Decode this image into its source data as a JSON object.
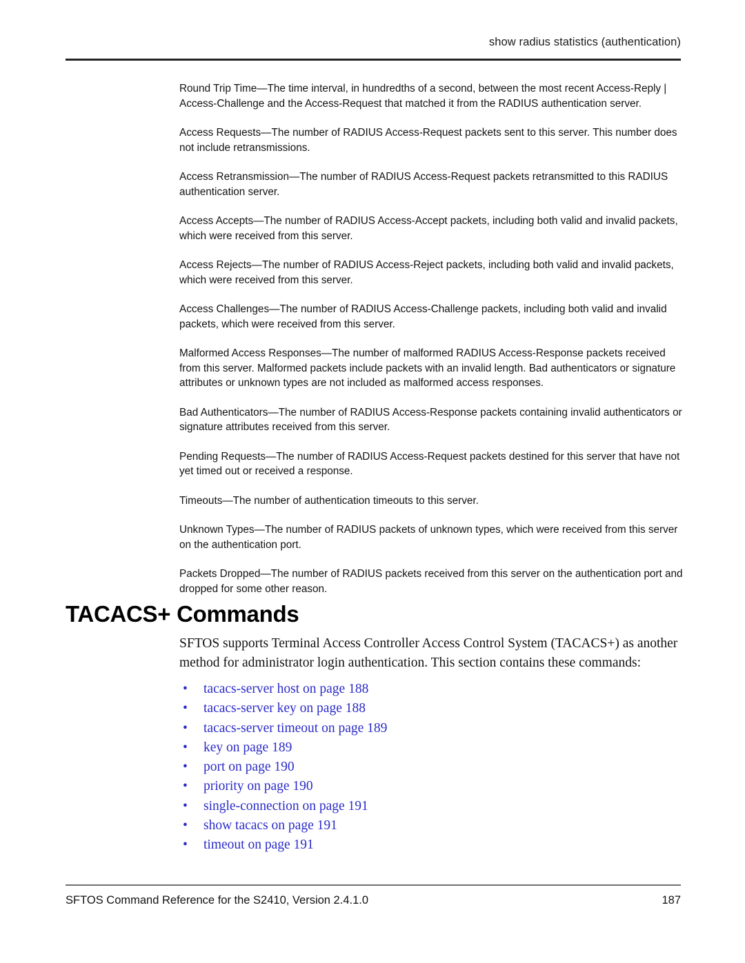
{
  "header": {
    "running_title": "show radius statistics (authentication)"
  },
  "body": {
    "paragraphs": [
      "Round Trip Time—The time interval, in hundredths of a second, between the most recent Access-Reply | Access-Challenge and the Access-Request that matched it from the RADIUS authentication server.",
      "Access Requests—The number of RADIUS Access-Request packets sent to this server. This number does not include retransmissions.",
      "Access Retransmission—The number of RADIUS Access-Request packets retransmitted to this RADIUS authentication server.",
      "Access Accepts—The number of RADIUS Access-Accept packets, including both valid and invalid packets, which were received from this server.",
      "Access Rejects—The number of RADIUS Access-Reject packets, including both valid and invalid packets, which were received from this server.",
      "Access Challenges—The number of RADIUS Access-Challenge packets, including both valid and invalid packets, which were received from this server.",
      "Malformed Access Responses—The number of malformed RADIUS Access-Response packets received from this server. Malformed packets include packets with an invalid length. Bad authenticators or signature attributes or unknown types are not included as malformed access responses.",
      "Bad Authenticators—The number of RADIUS Access-Response packets containing invalid authenticators or signature attributes received from this server.",
      "Pending Requests—The number of RADIUS Access-Request packets destined for this server that have not yet timed out or received a response.",
      "Timeouts—The number of authentication timeouts to this server.",
      "Unknown Types—The number of RADIUS packets of unknown types, which were received from this server on the authentication port.",
      "Packets Dropped—The number of RADIUS packets received from this server on the authentication port and dropped for some other reason."
    ]
  },
  "section": {
    "heading": "TACACS+ Commands",
    "intro": "SFTOS supports Terminal Access Controller Access Control System (TACACS+) as another method for administrator login authentication. This section contains these commands:",
    "bullet_glyph": "•",
    "link_color": "#2b2bc9",
    "links": [
      {
        "label": "tacacs-server host on page 188"
      },
      {
        "label": "tacacs-server key on page 188"
      },
      {
        "label": "tacacs-server timeout on page 189"
      },
      {
        "label": "key on page 189"
      },
      {
        "label": "port on page 190"
      },
      {
        "label": "priority on page 190"
      },
      {
        "label": "single-connection on page 191"
      },
      {
        "label": "show tacacs on page 191"
      },
      {
        "label": "timeout on page 191"
      }
    ]
  },
  "footer": {
    "document_title": "SFTOS Command Reference for the S2410, Version 2.4.1.0",
    "page_number": "187"
  }
}
